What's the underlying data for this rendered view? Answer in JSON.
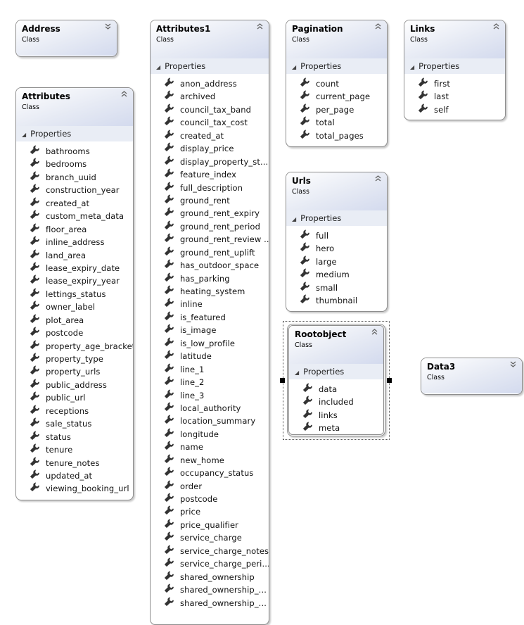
{
  "classes": [
    {
      "id": "address",
      "name": "Address",
      "kind": "Class",
      "collapsed": true,
      "properties": []
    },
    {
      "id": "attributes",
      "name": "Attributes",
      "kind": "Class",
      "collapsed": false,
      "section": "Properties",
      "properties": [
        "bathrooms",
        "bedrooms",
        "branch_uuid",
        "construction_year",
        "created_at",
        "custom_meta_data",
        "floor_area",
        "inline_address",
        "land_area",
        "lease_expiry_date",
        "lease_expiry_year",
        "lettings_status",
        "owner_label",
        "plot_area",
        "postcode",
        "property_age_bracket",
        "property_type",
        "property_urls",
        "public_address",
        "public_url",
        "receptions",
        "sale_status",
        "status",
        "tenure",
        "tenure_notes",
        "updated_at",
        "viewing_booking_url"
      ]
    },
    {
      "id": "attributes1",
      "name": "Attributes1",
      "kind": "Class",
      "collapsed": false,
      "section": "Properties",
      "properties": [
        "anon_address",
        "archived",
        "council_tax_band",
        "council_tax_cost",
        "created_at",
        "display_price",
        "display_property_st...",
        "feature_index",
        "full_description",
        "ground_rent",
        "ground_rent_expiry",
        "ground_rent_period",
        "ground_rent_review ...",
        "ground_rent_uplift",
        "has_outdoor_space",
        "has_parking",
        "heating_system",
        "inline",
        "is_featured",
        "is_image",
        "is_low_profile",
        "latitude",
        "line_1",
        "line_2",
        "line_3",
        "local_authority",
        "location_summary",
        "longitude",
        "name",
        "new_home",
        "occupancy_status",
        "order",
        "postcode",
        "price",
        "price_qualifier",
        "service_charge",
        "service_charge_notes",
        "service_charge_peri...",
        "shared_ownership",
        "shared_ownership_...",
        "shared_ownership_..."
      ]
    },
    {
      "id": "pagination",
      "name": "Pagination",
      "kind": "Class",
      "collapsed": false,
      "section": "Properties",
      "properties": [
        "count",
        "current_page",
        "per_page",
        "total",
        "total_pages"
      ]
    },
    {
      "id": "links",
      "name": "Links",
      "kind": "Class",
      "collapsed": false,
      "section": "Properties",
      "properties": [
        "first",
        "last",
        "self"
      ]
    },
    {
      "id": "urls",
      "name": "Urls",
      "kind": "Class",
      "collapsed": false,
      "section": "Properties",
      "properties": [
        "full",
        "hero",
        "large",
        "medium",
        "small",
        "thumbnail"
      ]
    },
    {
      "id": "rootobject",
      "name": "Rootobject",
      "kind": "Class",
      "collapsed": false,
      "selected": true,
      "section": "Properties",
      "properties": [
        "data",
        "included",
        "links",
        "meta"
      ]
    },
    {
      "id": "data3",
      "name": "Data3",
      "kind": "Class",
      "collapsed": true,
      "properties": []
    }
  ],
  "icons": {
    "property": "wrench-icon",
    "expand": "chevron-double-down-icon",
    "collapse": "chevron-double-up-icon",
    "section": "triangle-expanded-icon"
  }
}
